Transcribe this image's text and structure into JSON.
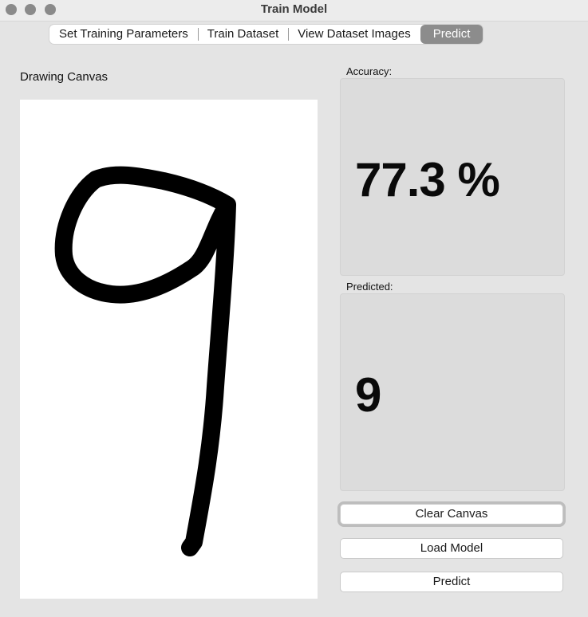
{
  "window": {
    "title": "Train Model"
  },
  "tabs": [
    {
      "label": "Set Training Parameters"
    },
    {
      "label": "Train Dataset"
    },
    {
      "label": "View Dataset Images"
    },
    {
      "label": "Predict",
      "active": true
    }
  ],
  "canvas": {
    "label": "Drawing Canvas"
  },
  "accuracy": {
    "label": "Accuracy:",
    "value": "77.3 %"
  },
  "predicted": {
    "label": "Predicted:",
    "value": "9"
  },
  "buttons": {
    "clear": "Clear Canvas",
    "load": "Load Model",
    "predict": "Predict"
  },
  "colors": {
    "active_tab": "#8c8c8c",
    "panel_bg": "#dcdcdc",
    "stroke": "#000000"
  }
}
